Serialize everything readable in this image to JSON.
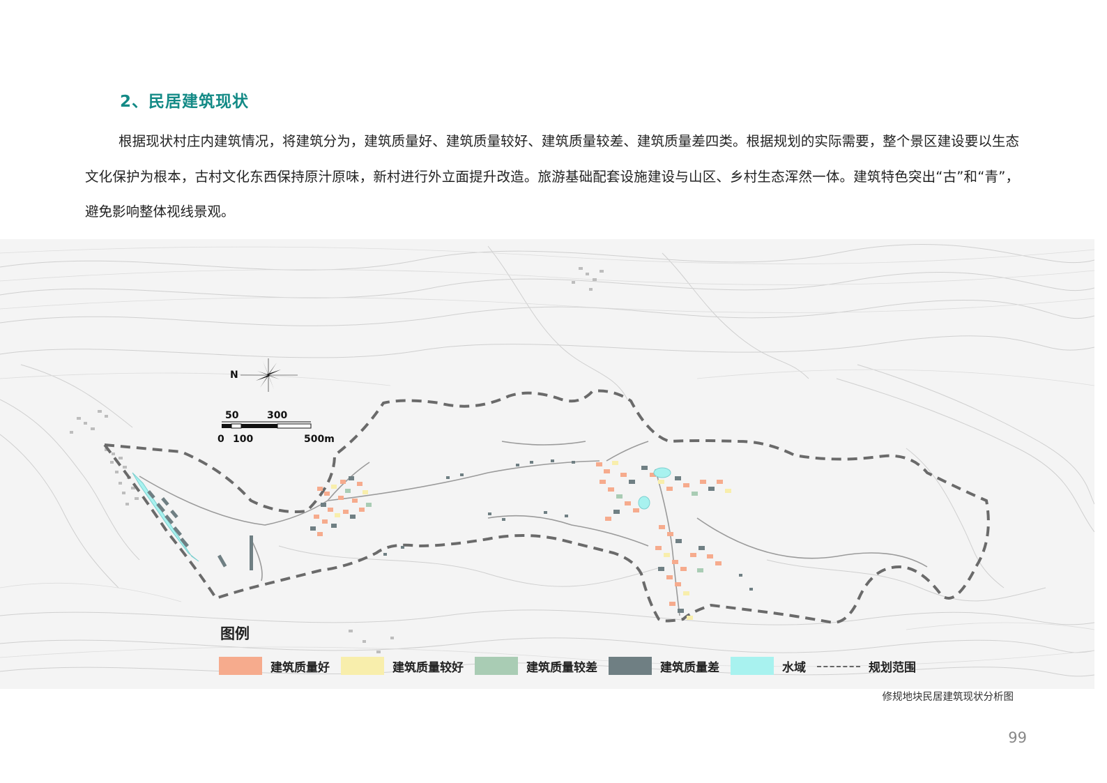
{
  "section_title": "2、民居建筑现状",
  "paragraph": "根据现状村庄内建筑情况，将建筑分为，建筑质量好、建筑质量较好、建筑质量较差、建筑质量差四类。根据规划的实际需要，整个景区建设要以生态文化保护为根本，古村文化东西保持原汁原味，新村进行外立面提升改造。旅游基础配套设施建设与山区、乡村生态浑然一体。建筑特色突出“古”和“青”，避免影响整体视线景观。",
  "map": {
    "north_label": "N",
    "scale_labels": {
      "top_left": "50",
      "top_right": "300",
      "bottom_zero": "0",
      "bottom_mid": "100",
      "bottom_end": "500m"
    }
  },
  "legend": {
    "title": "图例",
    "items": [
      {
        "label": "建筑质量好",
        "color": "#f6ab8d"
      },
      {
        "label": "建筑质量较好",
        "color": "#f8eeac"
      },
      {
        "label": "建筑质量较差",
        "color": "#a9ccb4"
      },
      {
        "label": "建筑质量差",
        "color": "#6f7f83"
      },
      {
        "label": "水域",
        "color": "#a8f2ef"
      },
      {
        "label": "规划范围",
        "color": "#666666",
        "style": "dashed-line"
      }
    ]
  },
  "caption": "修规地块民居建筑现状分析图",
  "page_number": "99"
}
